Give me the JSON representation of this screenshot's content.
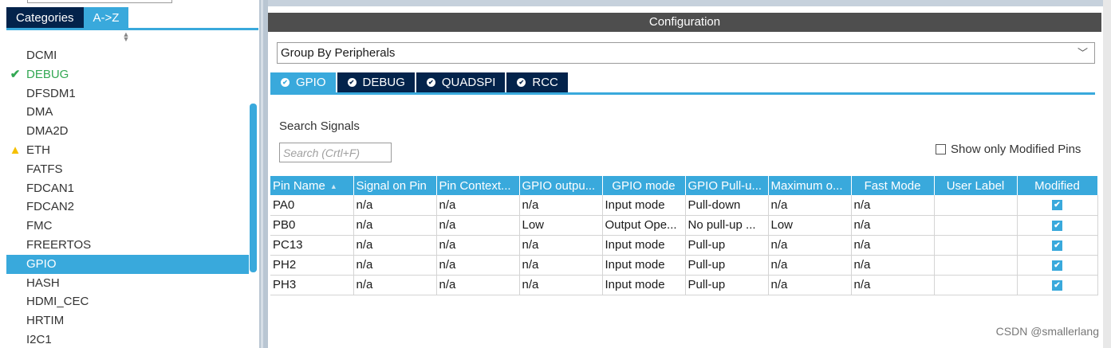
{
  "categories_tabs": [
    {
      "label": "Categories"
    },
    {
      "label": "A->Z"
    }
  ],
  "sidebar": {
    "items": [
      {
        "label": "DCMI",
        "status": ""
      },
      {
        "label": "DEBUG",
        "status": "configured"
      },
      {
        "label": "DFSDM1",
        "status": ""
      },
      {
        "label": "DMA",
        "status": ""
      },
      {
        "label": "DMA2D",
        "status": ""
      },
      {
        "label": "ETH",
        "status": "warning"
      },
      {
        "label": "FATFS",
        "status": ""
      },
      {
        "label": "FDCAN1",
        "status": ""
      },
      {
        "label": "FDCAN2",
        "status": ""
      },
      {
        "label": "FMC",
        "status": ""
      },
      {
        "label": "FREERTOS",
        "status": ""
      },
      {
        "label": "GPIO",
        "status": "selected"
      },
      {
        "label": "HASH",
        "status": ""
      },
      {
        "label": "HDMI_CEC",
        "status": ""
      },
      {
        "label": "HRTIM",
        "status": ""
      },
      {
        "label": "I2C1",
        "status": ""
      }
    ]
  },
  "config": {
    "title": "Configuration",
    "group_select": "Group By Peripherals",
    "tabs": [
      {
        "label": "GPIO",
        "active": true
      },
      {
        "label": "DEBUG",
        "active": false
      },
      {
        "label": "QUADSPI",
        "active": false
      },
      {
        "label": "RCC",
        "active": false
      }
    ],
    "search_label": "Search Signals",
    "search_placeholder": "Search (Crtl+F)",
    "modified_toggle_label": "Show only Modified Pins"
  },
  "table": {
    "columns": [
      "Pin Name",
      "Signal on Pin",
      "Pin Context...",
      "GPIO outpu...",
      "GPIO mode",
      "GPIO Pull-u...",
      "Maximum o...",
      "Fast Mode",
      "User Label",
      "Modified"
    ],
    "rows": [
      [
        "PA0",
        "n/a",
        "n/a",
        "n/a",
        "Input mode",
        "Pull-down",
        "n/a",
        "n/a",
        "",
        true
      ],
      [
        "PB0",
        "n/a",
        "n/a",
        "Low",
        "Output Ope...",
        "No pull-up ...",
        "Low",
        "n/a",
        "",
        true
      ],
      [
        "PC13",
        "n/a",
        "n/a",
        "n/a",
        "Input mode",
        "Pull-up",
        "n/a",
        "n/a",
        "",
        true
      ],
      [
        "PH2",
        "n/a",
        "n/a",
        "n/a",
        "Input mode",
        "Pull-up",
        "n/a",
        "n/a",
        "",
        true
      ],
      [
        "PH3",
        "n/a",
        "n/a",
        "n/a",
        "Input mode",
        "Pull-up",
        "n/a",
        "n/a",
        "",
        true
      ]
    ]
  },
  "watermark": "CSDN @smallerlang",
  "colors": {
    "accent": "#39a9dc",
    "dark_tab": "#03234b",
    "header_bar": "#4e4e4e",
    "ok_green": "#33a853",
    "warning_yellow": "#f5c000"
  }
}
